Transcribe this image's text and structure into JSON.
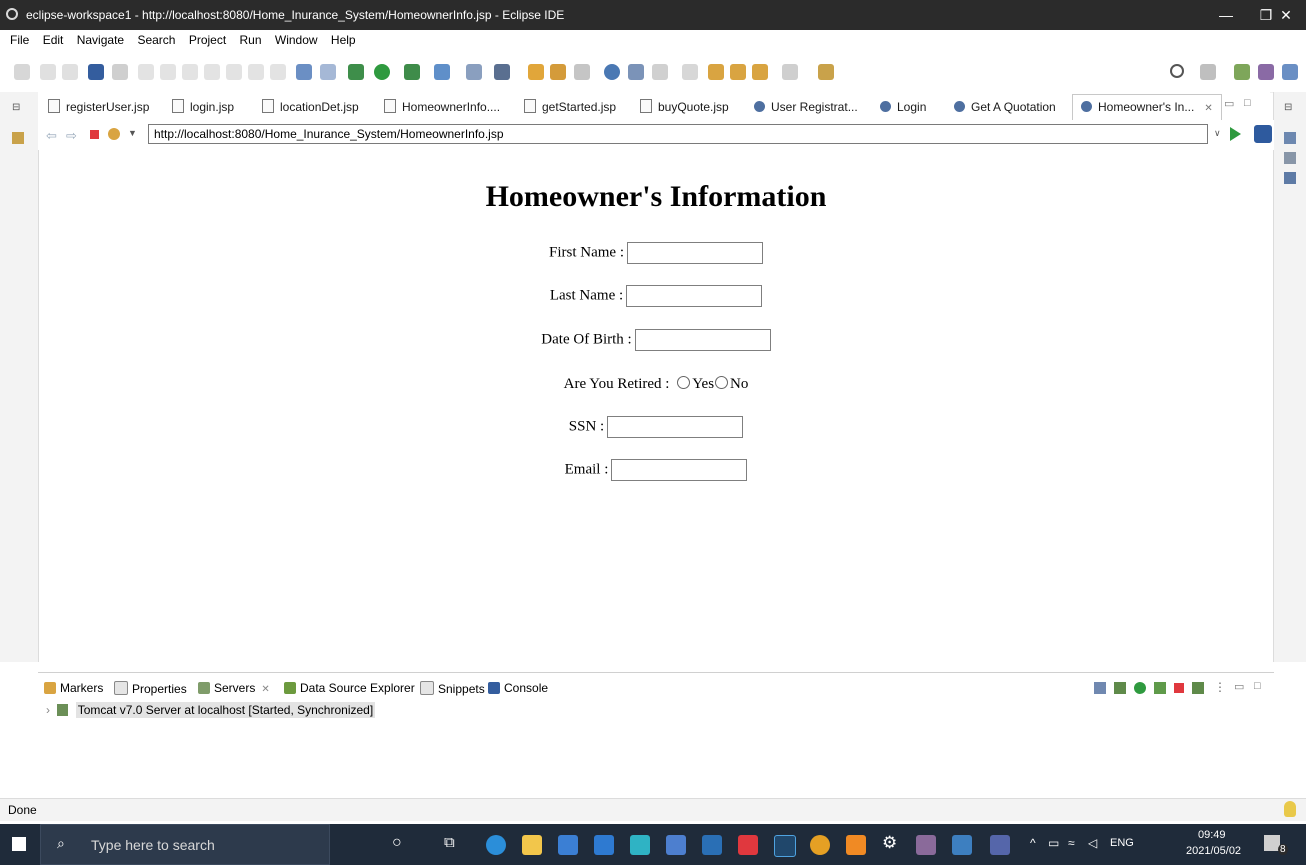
{
  "window": {
    "title": "eclipse-workspace1 - http://localhost:8080/Home_Inurance_System/HomeownerInfo.jsp - Eclipse IDE",
    "min_glyph": "—",
    "max_glyph": "❐",
    "close_glyph": "✕"
  },
  "menu": [
    "File",
    "Edit",
    "Navigate",
    "Search",
    "Project",
    "Run",
    "Window",
    "Help"
  ],
  "tabs": [
    {
      "label": "registerUser.jsp",
      "kind": "file"
    },
    {
      "label": "login.jsp",
      "kind": "file"
    },
    {
      "label": "locationDet.jsp",
      "kind": "file"
    },
    {
      "label": "HomeownerInfo....",
      "kind": "file"
    },
    {
      "label": "getStarted.jsp",
      "kind": "file"
    },
    {
      "label": "buyQuote.jsp",
      "kind": "file"
    },
    {
      "label": "User Registrat...",
      "kind": "web"
    },
    {
      "label": "Login",
      "kind": "web"
    },
    {
      "label": "Get A Quotation",
      "kind": "web"
    },
    {
      "label": "Homeowner's In...",
      "kind": "web",
      "active": true
    }
  ],
  "tab_close_glyph": "✕",
  "address": {
    "url": "http://localhost:8080/Home_Inurance_System/HomeownerInfo.jsp"
  },
  "page": {
    "heading": "Homeowner's Information",
    "fields": [
      {
        "label": "First Name :",
        "value": ""
      },
      {
        "label": "Last Name :",
        "value": ""
      },
      {
        "label": "Date Of Birth :",
        "value": ""
      },
      {
        "label": "SSN :",
        "value": ""
      },
      {
        "label": "Email :",
        "value": ""
      }
    ],
    "retired": {
      "label": "Are You Retired :",
      "options": [
        "Yes",
        "No"
      ]
    }
  },
  "bottom_panel": {
    "tabs": [
      "Markers",
      "Properties",
      "Servers",
      "Data Source Explorer",
      "Snippets",
      "Console"
    ],
    "server": "Tomcat v7.0 Server at localhost  [Started, Synchronized]"
  },
  "status": "Done",
  "taskbar": {
    "search_placeholder": "Type here to search",
    "tray_lang": "ENG",
    "time": "09:49",
    "date": "2021/05/02",
    "notifications": "8"
  },
  "colors": {
    "titlebar": "#2b2b2b",
    "taskbar": "#1f2b3a",
    "eclipse_accent": "#2e5a9e"
  }
}
